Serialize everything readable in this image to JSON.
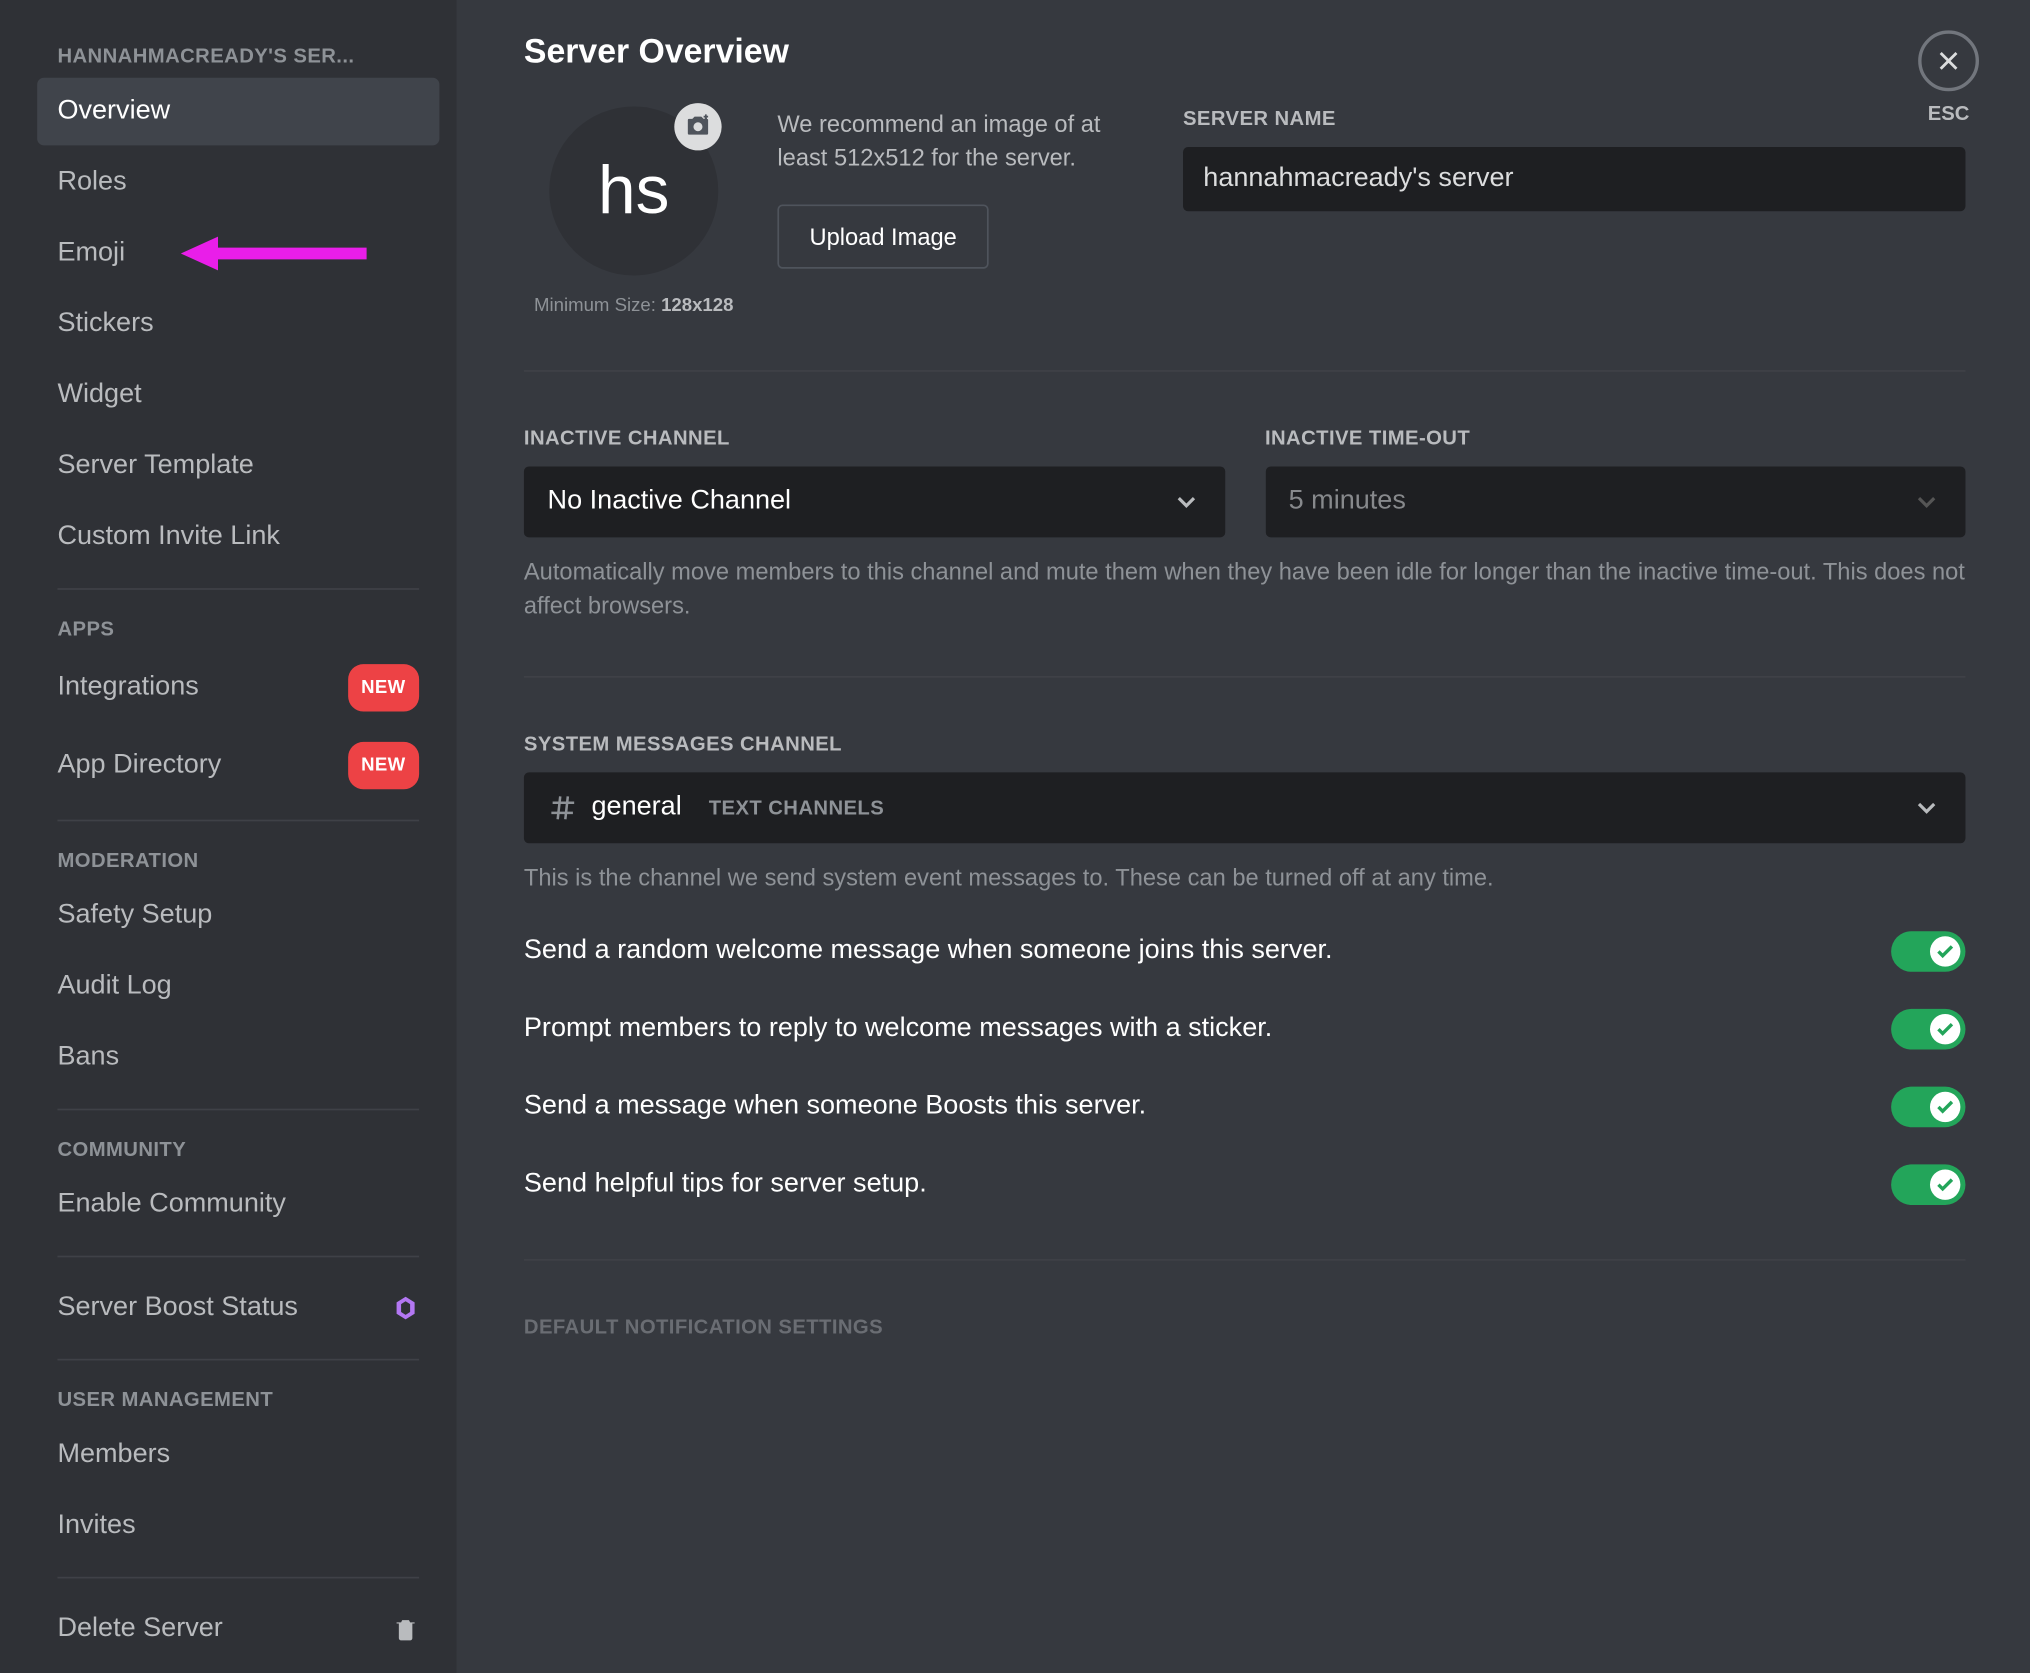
{
  "sidebar": {
    "serverHeading": "HANNAHMACREADY'S SER...",
    "items": {
      "overview": "Overview",
      "roles": "Roles",
      "emoji": "Emoji",
      "stickers": "Stickers",
      "widget": "Widget",
      "serverTemplate": "Server Template",
      "customInvite": "Custom Invite Link"
    },
    "appsHeading": "APPS",
    "integrations": "Integrations",
    "appDirectory": "App Directory",
    "newBadge": "NEW",
    "moderationHeading": "MODERATION",
    "safetySetup": "Safety Setup",
    "auditLog": "Audit Log",
    "bans": "Bans",
    "communityHeading": "COMMUNITY",
    "enableCommunity": "Enable Community",
    "serverBoost": "Server Boost Status",
    "userMgmtHeading": "USER MANAGEMENT",
    "members": "Members",
    "invites": "Invites",
    "deleteServer": "Delete Server"
  },
  "close": {
    "label": "ESC"
  },
  "page": {
    "title": "Server Overview",
    "avatarInitials": "hs",
    "minSizePrefix": "Minimum Size: ",
    "minSizeValue": "128x128",
    "recommendText": "We recommend an image of at least 512x512 for the server.",
    "uploadButton": "Upload Image",
    "serverNameLabel": "SERVER NAME",
    "serverNameValue": "hannahmacready's server",
    "inactiveChannelLabel": "INACTIVE CHANNEL",
    "inactiveChannelValue": "No Inactive Channel",
    "inactiveTimeoutLabel": "INACTIVE TIME-OUT",
    "inactiveTimeoutValue": "5 minutes",
    "inactiveHelp": "Automatically move members to this channel and mute them when they have been idle for longer than the inactive time-out. This does not affect browsers.",
    "systemChannelLabel": "SYSTEM MESSAGES CHANNEL",
    "systemChannelName": "general",
    "systemChannelCategory": "TEXT CHANNELS",
    "systemChannelHelp": "This is the channel we send system event messages to. These can be turned off at any time.",
    "toggles": [
      "Send a random welcome message when someone joins this server.",
      "Prompt members to reply to welcome messages with a sticker.",
      "Send a message when someone Boosts this server.",
      "Send helpful tips for server setup."
    ],
    "defaultNotifHeading": "DEFAULT NOTIFICATION SETTINGS"
  },
  "colors": {
    "accentGreen": "#23a55a",
    "badgeRed": "#ed4245",
    "arrow": "#e91ee9"
  }
}
